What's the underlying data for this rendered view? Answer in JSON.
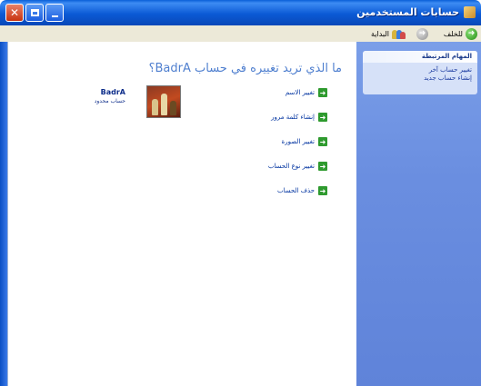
{
  "window": {
    "title": "حسابات المستخدمين"
  },
  "toolbar": {
    "back_label": "للخلف",
    "home_label": "البداية"
  },
  "main": {
    "heading": "ما الذي تريد تغييره في حساب BadrA؟",
    "tasks": [
      {
        "label": "تغيير الاسم",
        "icon": "green-arrow-icon"
      },
      {
        "label": "إنشاء كلمة مرور",
        "icon": "green-arrow-icon"
      },
      {
        "label": "تغيير الصورة",
        "icon": "green-arrow-icon"
      },
      {
        "label": "تغيير نوع الحساب",
        "icon": "green-arrow-icon"
      },
      {
        "label": "حذف الحساب",
        "icon": "green-arrow-icon"
      }
    ],
    "account": {
      "name": "BadrA",
      "type": "حساب محدود"
    }
  },
  "sidepanel": {
    "title": "المهام المرتبطة",
    "links": [
      "تغيير حساب آخر",
      "إنشاء حساب جديد"
    ]
  },
  "colors": {
    "titlebar": "#0b5ad5",
    "toolbar": "#ece9d8",
    "heading": "#4f7fcf",
    "sidebar": "#6a8ee0"
  }
}
